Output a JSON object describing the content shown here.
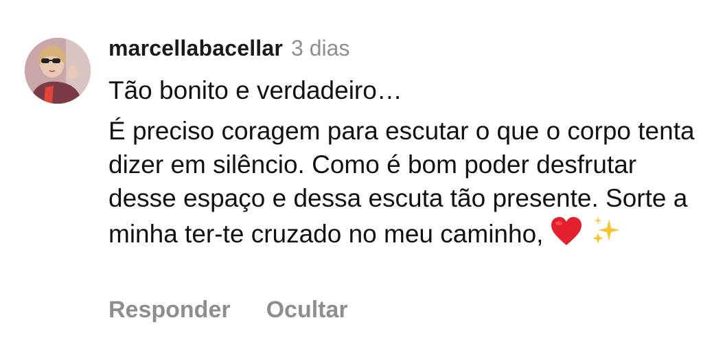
{
  "comment": {
    "username": "marcellabacellar",
    "time": "3 dias",
    "line1": "Tão bonito e verdadeiro…",
    "body": "É preciso coragem para escutar o que o corpo tenta dizer em silêncio. Como é bom poder desfrutar desse espaço e dessa escuta tão presente. Sorte a minha ter-te cruzado no meu caminho,",
    "emojis": [
      "heart-emoji",
      "sparkles-emoji"
    ]
  },
  "actions": {
    "reply_label": "Responder",
    "hide_label": "Ocultar"
  },
  "colors": {
    "muted": "#8e8e8e",
    "text": "#111111",
    "heart": "#e4202e",
    "sparkles": "#f7c331"
  }
}
